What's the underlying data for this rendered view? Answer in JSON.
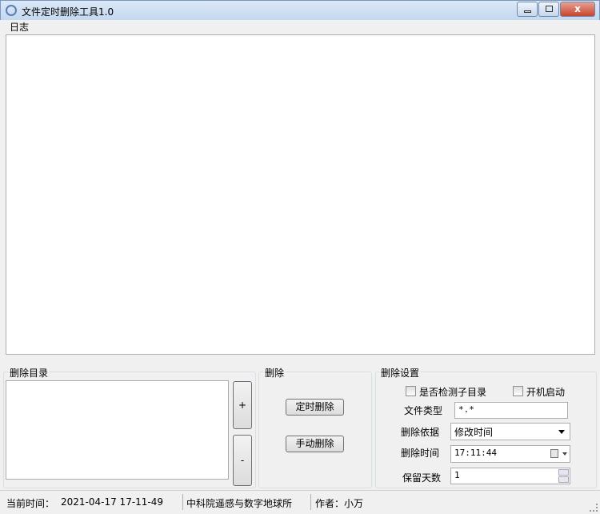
{
  "window": {
    "title": "文件定时删除工具1.0",
    "close": "x"
  },
  "log": {
    "label": "日志"
  },
  "dirs": {
    "label": "删除目录",
    "add": "+",
    "remove": "-"
  },
  "delete": {
    "label": "删除",
    "timed": "定时删除",
    "manual": "手动删除"
  },
  "settings": {
    "label": "删除设置",
    "check_subdirs": "是否检测子目录",
    "autostart": "开机启动",
    "file_type_label": "文件类型",
    "file_type": "*.*",
    "basis_label": "删除依据",
    "basis": "修改时间",
    "time_label": "删除时间",
    "time": "17:11:44",
    "days_label": "保留天数",
    "days": "1"
  },
  "status": {
    "time_label": "当前时间：",
    "time": "2021-04-17 17-11-49",
    "org": "中科院遥感与数字地球所",
    "author": "作者：小万"
  }
}
